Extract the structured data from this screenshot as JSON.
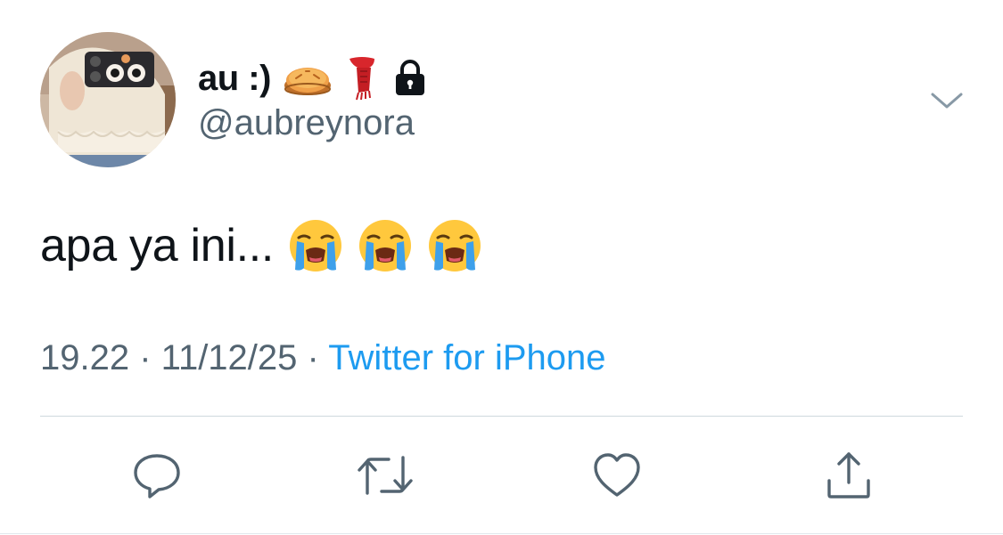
{
  "author": {
    "display_name": "au :)",
    "name_emojis": [
      "pie-emoji",
      "scarf-emoji",
      "lock-icon"
    ],
    "handle": "@aubreynora"
  },
  "tweet": {
    "text": "apa ya ini...",
    "emojis": [
      "loudly-crying-face-emoji",
      "loudly-crying-face-emoji",
      "loudly-crying-face-emoji"
    ]
  },
  "meta": {
    "time": "19.22",
    "separator": "·",
    "date": "11/12/25",
    "source": "Twitter for iPhone"
  },
  "actions": [
    "reply-icon",
    "retweet-icon",
    "like-icon",
    "share-icon"
  ],
  "colors": {
    "text": "#0f1419",
    "secondary": "#536471",
    "accent": "#1d9bf0",
    "divider": "#cfd9de"
  }
}
